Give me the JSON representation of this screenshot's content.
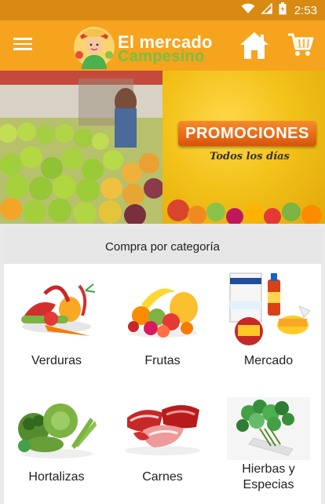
{
  "status_bar": {
    "time": "2:53",
    "icons": [
      "wifi-icon",
      "signal-icon",
      "battery-icon"
    ]
  },
  "app_bar": {
    "logo_line1": "El mercado",
    "logo_line2": "Campesino",
    "menu_icon": "menu-icon",
    "home_icon": "home-icon",
    "cart_icon": "cart-icon"
  },
  "banner": {
    "promo_title": "PROMOCIONES",
    "promo_subtitle": "Todos los días"
  },
  "categories": {
    "header": "Compra por categoría",
    "items": [
      {
        "label": "Verduras"
      },
      {
        "label": "Frutas"
      },
      {
        "label": "Mercado"
      },
      {
        "label": "Hortalizas"
      },
      {
        "label": "Carnes"
      },
      {
        "label": "Hierbas y Especias"
      }
    ]
  },
  "colors": {
    "app_bar": "#f6a31e",
    "status_bar": "#d88a12",
    "accent_green": "#76c043",
    "promo": "#e8641a"
  }
}
